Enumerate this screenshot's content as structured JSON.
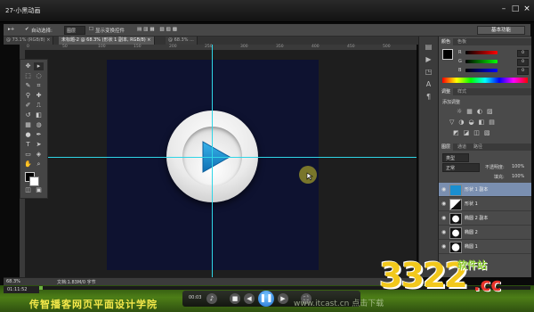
{
  "window": {
    "title": "27-小黑动画"
  },
  "options": {
    "auto_select": "自动选择:",
    "group": "图层",
    "show_transform": "显示变换控件",
    "workspace": "基本功能"
  },
  "tabs": [
    {
      "label": "@ 73.1% (RGB/8) ×"
    },
    {
      "label": "未标题-2 @ 68.3% (形状 1 副本, RGB/8) ×"
    },
    {
      "label": "@ 68.3% ..."
    }
  ],
  "ruler_ticks": [
    "0",
    "50",
    "100",
    "150",
    "200",
    "250",
    "300",
    "350",
    "400",
    "450",
    "500"
  ],
  "color_panel": {
    "tabs": [
      "颜色",
      "色板"
    ],
    "channels": [
      {
        "name": "R",
        "value": "0"
      },
      {
        "name": "G",
        "value": "0"
      },
      {
        "name": "B",
        "value": "0"
      }
    ]
  },
  "adjust_panel": {
    "tabs": [
      "调整",
      "样式"
    ],
    "hint": "添加调整"
  },
  "layers_panel": {
    "tabs": [
      "图层",
      "通道",
      "路径"
    ],
    "kind": "类型",
    "blend": "正常",
    "opacity_label": "不透明度:",
    "opacity": "100%",
    "fill_label": "填充:",
    "fill": "100%",
    "layers": [
      {
        "name": "形状 1 副本",
        "selected": true
      },
      {
        "name": "形状 1",
        "selected": false
      },
      {
        "name": "椭圆 2 副本",
        "selected": false
      },
      {
        "name": "椭圆 2",
        "selected": false
      },
      {
        "name": "椭圆 1",
        "selected": false
      }
    ]
  },
  "status": {
    "zoom": "68.3%",
    "doc": "文档:1.83M/0 字节",
    "time": "01:11:52"
  },
  "player": {
    "time_current": "00:03",
    "footer": "传智播客网页平面设计学院",
    "footer_right": "www.itcast.cn 点击下载"
  },
  "watermark": {
    "number": "3322",
    "cn": "软件站",
    "domain": ".cc"
  },
  "colors": {
    "guide": "#2fd5e6",
    "canvas": "#0e1230",
    "play_blue": "#1a8fd0",
    "player_green": "#4d7e17"
  }
}
